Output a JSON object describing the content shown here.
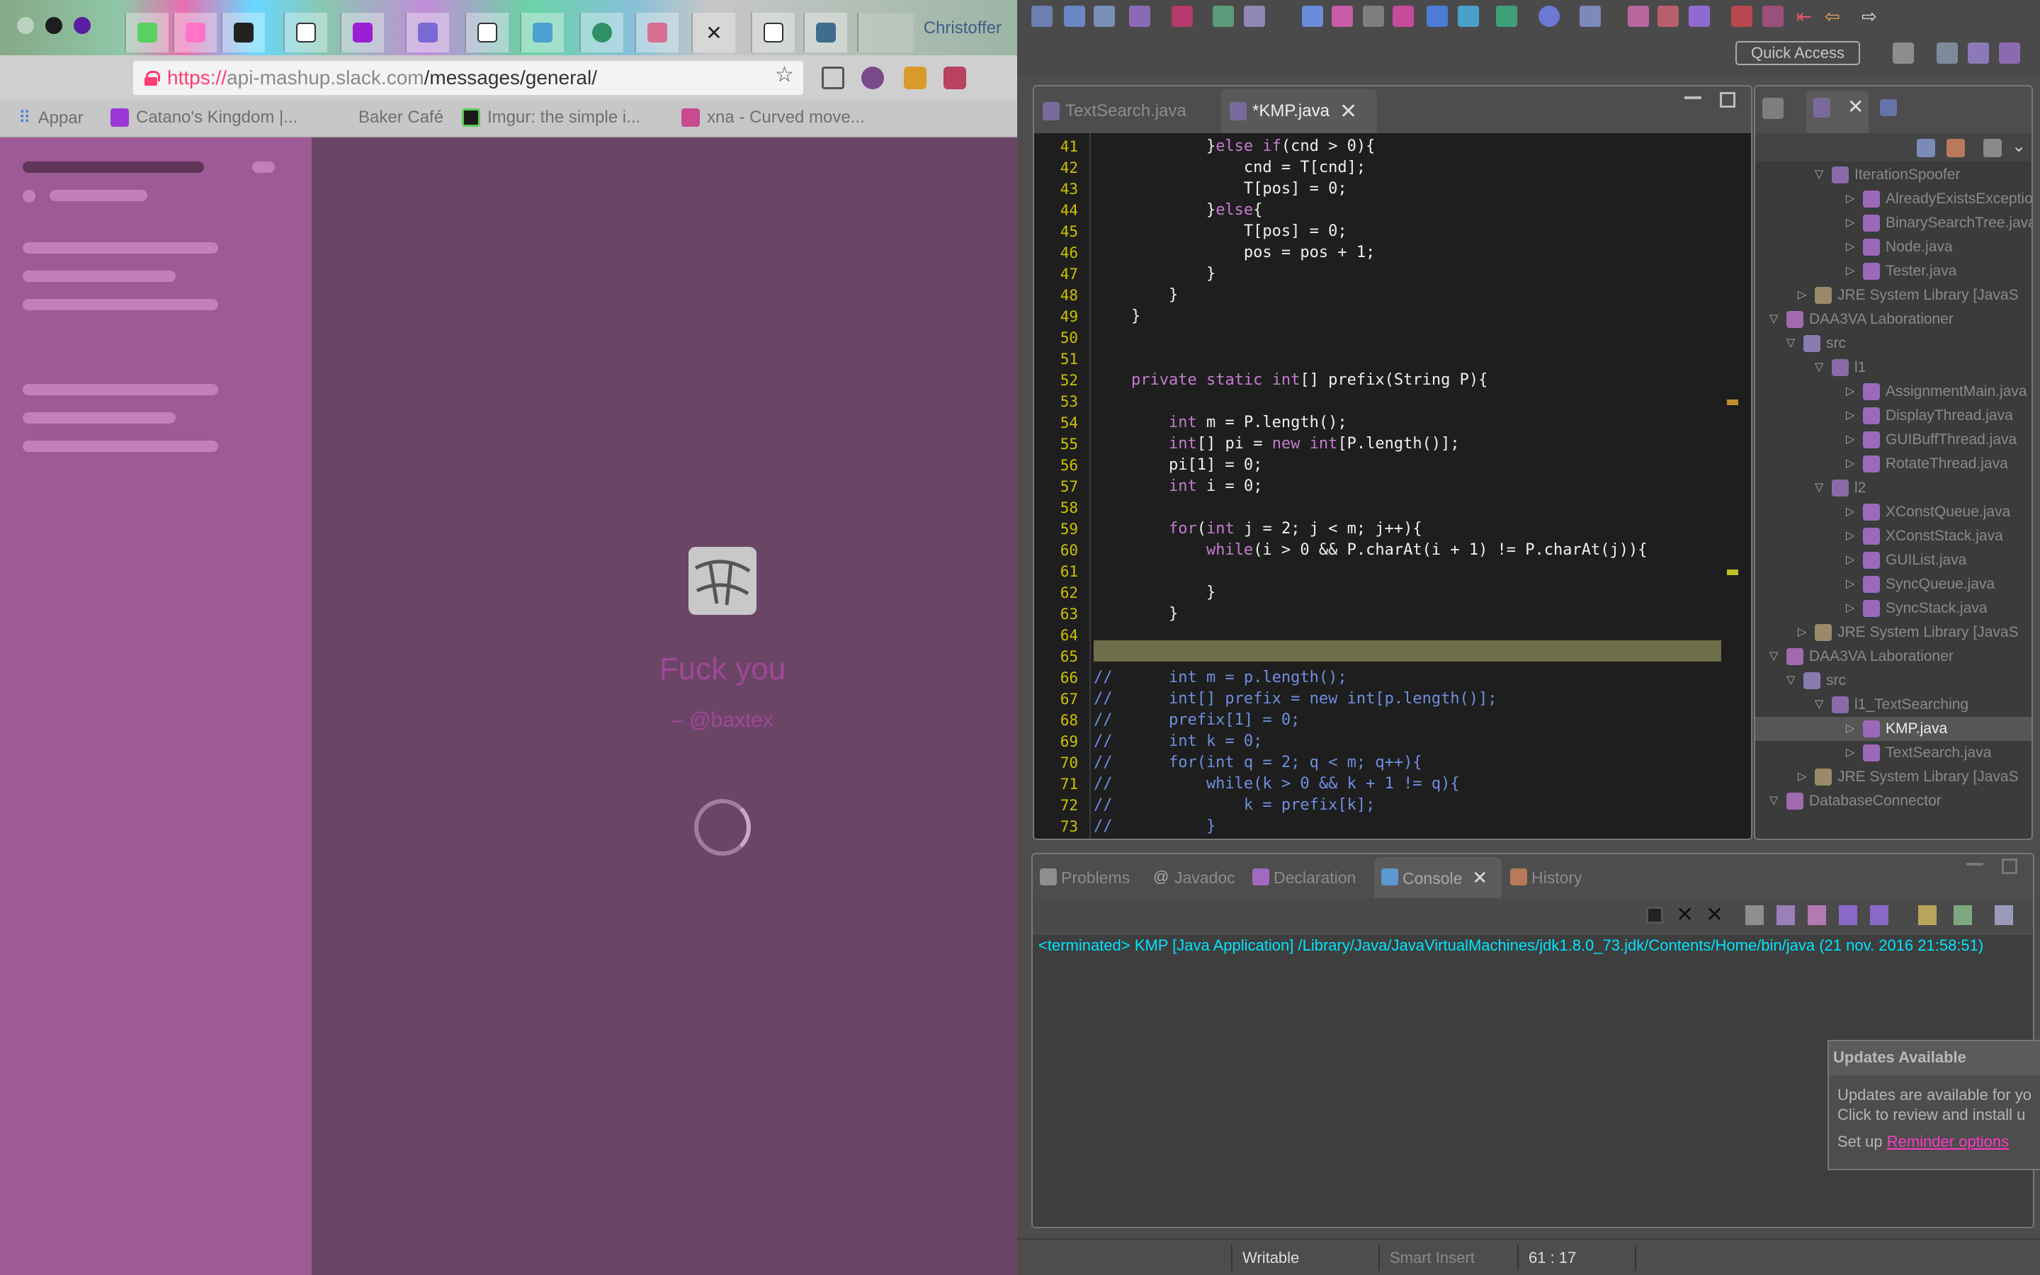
{
  "browser": {
    "profile_name": "Christoffer",
    "address_bar": {
      "scheme": "https://",
      "host": "api-mashup.slack.com",
      "path": "/messages/general/"
    },
    "bookmarks": [
      {
        "label": "Appar",
        "icon": "apps-grid-icon"
      },
      {
        "label": "Catano's Kingdom |...",
        "icon": "kingdom-icon"
      },
      {
        "label": "Baker Café",
        "icon": "cafe-icon"
      },
      {
        "label": "Imgur: the simple i...",
        "icon": "imgur-icon"
      },
      {
        "label": "xna - Curved move...",
        "icon": "xna-icon"
      }
    ],
    "loading": {
      "quote": "Fuck you",
      "author": "– @baxtex"
    }
  },
  "eclipse": {
    "quick_access": "Quick Access",
    "editor": {
      "tabs": [
        {
          "label": "TextSearch.java",
          "active": false
        },
        {
          "label": "*KMP.java",
          "active": true
        }
      ],
      "lines": [
        {
          "n": "41",
          "text": "            }else if(cnd > 0){"
        },
        {
          "n": "42",
          "text": "                cnd = T[cnd];"
        },
        {
          "n": "43",
          "text": "                T[pos] = 0;"
        },
        {
          "n": "44",
          "text": "            }else{"
        },
        {
          "n": "45",
          "text": "                T[pos] = 0;"
        },
        {
          "n": "46",
          "text": "                pos = pos + 1;"
        },
        {
          "n": "47",
          "text": "            }"
        },
        {
          "n": "48",
          "text": "        }"
        },
        {
          "n": "49",
          "text": "    }"
        },
        {
          "n": "50",
          "text": ""
        },
        {
          "n": "51",
          "text": ""
        },
        {
          "n": "52",
          "text": "    private static int[] prefix(String P){"
        },
        {
          "n": "53",
          "text": ""
        },
        {
          "n": "54",
          "text": "        int m = P.length();"
        },
        {
          "n": "55",
          "text": "        int[] pi = new int[P.length()];"
        },
        {
          "n": "56",
          "text": "        pi[1] = 0;"
        },
        {
          "n": "57",
          "text": "        int i = 0;"
        },
        {
          "n": "58",
          "text": ""
        },
        {
          "n": "59",
          "text": "        for(int j = 2; j < m; j++){"
        },
        {
          "n": "60",
          "text": "            while(i > 0 && P.charAt(i + 1) != P.charAt(j)){"
        },
        {
          "n": "61",
          "text": ""
        },
        {
          "n": "62",
          "text": "            }"
        },
        {
          "n": "63",
          "text": "        }"
        },
        {
          "n": "64",
          "text": ""
        },
        {
          "n": "65",
          "text": ""
        },
        {
          "n": "66",
          "text": "//      int m = p.length();"
        },
        {
          "n": "67",
          "text": "//      int[] prefix = new int[p.length()];"
        },
        {
          "n": "68",
          "text": "//      prefix[1] = 0;"
        },
        {
          "n": "69",
          "text": "//      int k = 0;"
        },
        {
          "n": "70",
          "text": "//      for(int q = 2; q < m; q++){"
        },
        {
          "n": "71",
          "text": "//          while(k > 0 && k + 1 != q){"
        },
        {
          "n": "72",
          "text": "//              k = prefix[k];"
        },
        {
          "n": "73",
          "text": "//          }"
        }
      ]
    },
    "explorer": {
      "items": [
        {
          "label": "IterationSpoofer",
          "icon": "package-icon"
        },
        {
          "label": "AlreadyExistsException",
          "icon": "java-file-icon"
        },
        {
          "label": "BinarySearchTree.java",
          "icon": "java-file-icon"
        },
        {
          "label": "Node.java",
          "icon": "java-file-icon"
        },
        {
          "label": "Tester.java",
          "icon": "java-file-icon"
        },
        {
          "label": "JRE System Library [JavaS",
          "icon": "library-icon"
        },
        {
          "label": "DAA3VA Laborationer",
          "icon": "project-icon"
        },
        {
          "label": "src",
          "icon": "src-folder-icon"
        },
        {
          "label": "l1",
          "icon": "package-icon"
        },
        {
          "label": "AssignmentMain.java",
          "icon": "java-file-icon"
        },
        {
          "label": "DisplayThread.java",
          "icon": "java-file-icon"
        },
        {
          "label": "GUIBuffThread.java",
          "icon": "java-file-icon"
        },
        {
          "label": "RotateThread.java",
          "icon": "java-file-icon"
        },
        {
          "label": "l2",
          "icon": "package-icon"
        },
        {
          "label": "XConstQueue.java",
          "icon": "java-file-icon"
        },
        {
          "label": "XConstStack.java",
          "icon": "java-file-icon"
        },
        {
          "label": "GUIList.java",
          "icon": "java-file-icon"
        },
        {
          "label": "SyncQueue.java",
          "icon": "java-file-icon"
        },
        {
          "label": "SyncStack.java",
          "icon": "java-file-icon"
        },
        {
          "label": "JRE System Library [JavaS",
          "icon": "library-icon"
        },
        {
          "label": "DAA3VA Laborationer",
          "icon": "project-icon"
        },
        {
          "label": "src",
          "icon": "src-folder-icon"
        },
        {
          "label": "l1_TextSearching",
          "icon": "package-icon"
        },
        {
          "label": "KMP.java",
          "icon": "java-file-icon"
        },
        {
          "label": "TextSearch.java",
          "icon": "java-file-icon"
        },
        {
          "label": "JRE System Library [JavaS",
          "icon": "library-icon"
        },
        {
          "label": "DatabaseConnector",
          "icon": "project-icon"
        }
      ]
    },
    "console": {
      "tabs": [
        {
          "label": "Problems",
          "icon": "problems-icon"
        },
        {
          "label": "Javadoc",
          "icon": "javadoc-icon"
        },
        {
          "label": "Declaration",
          "icon": "declaration-icon"
        },
        {
          "label": "Console",
          "icon": "console-icon",
          "active": true
        },
        {
          "label": "History",
          "icon": "history-icon"
        }
      ],
      "status": "<terminated> KMP [Java Application] /Library/Java/JavaVirtualMachines/jdk1.8.0_73.jdk/Contents/Home/bin/java (21 nov. 2016 21:58:51)"
    },
    "updates": {
      "title": "Updates Available",
      "body_line1": "Updates are available for yo",
      "body_line2": "Click to review and install u",
      "setup_prefix": "Set up",
      "setup_link": "Reminder options"
    },
    "statusbar": {
      "writable": "Writable",
      "insert_mode": "Smart Insert",
      "position": "61 : 17"
    }
  }
}
